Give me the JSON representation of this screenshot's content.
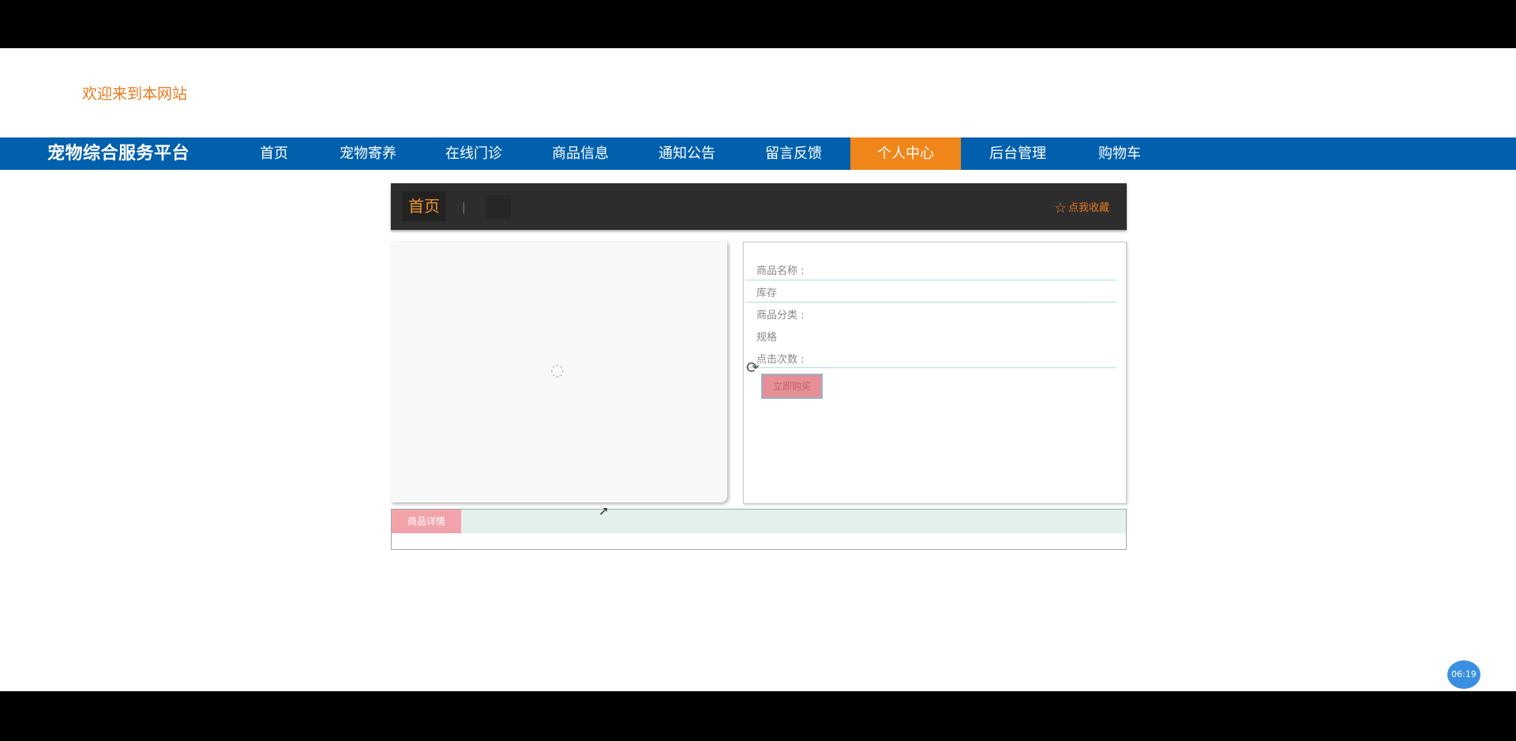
{
  "header": {
    "welcome": "欢迎来到本网站"
  },
  "nav": {
    "brand": "宠物综合服务平台",
    "items": [
      "首页",
      "宠物寄养",
      "在线门诊",
      "商品信息",
      "通知公告",
      "留言反馈",
      "个人中心",
      "后台管理",
      "购物车"
    ],
    "active": "个人中心",
    "colors": {
      "bar": "#0060ad",
      "active": "#f08519"
    }
  },
  "tabbar": {
    "home_tab": "首页",
    "separator": "|",
    "favorite_label": "点我收藏"
  },
  "product": {
    "rows": [
      {
        "label": "商品名称 :"
      },
      {
        "label": "库存"
      },
      {
        "label": "商品分类 :"
      },
      {
        "label": "规格"
      },
      {
        "label": "点击次数 :"
      }
    ],
    "buy_button": "立即购买"
  },
  "detail": {
    "tab_label": "商品详情"
  },
  "overlay": {
    "clock": "06:19"
  }
}
